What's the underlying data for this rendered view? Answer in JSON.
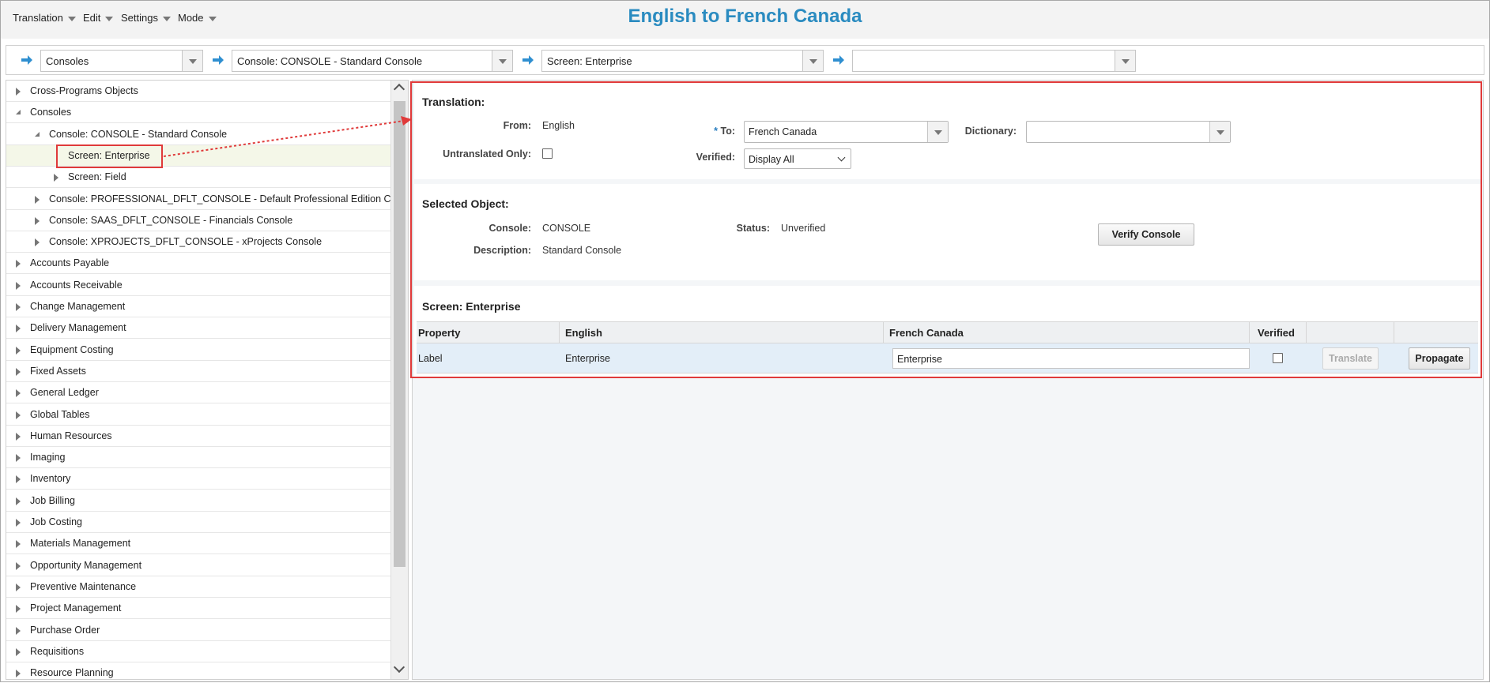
{
  "menu": [
    {
      "label": "Translation"
    },
    {
      "label": "Edit"
    },
    {
      "label": "Settings"
    },
    {
      "label": "Mode"
    }
  ],
  "title": "English to French Canada",
  "breadcrumbs": [
    {
      "value": "Consoles"
    },
    {
      "value": "Console: CONSOLE - Standard Console"
    },
    {
      "value": "Screen: Enterprise"
    },
    {
      "value": ""
    }
  ],
  "tree": [
    {
      "label": "Cross-Programs Objects",
      "level": 0,
      "state": "collapsed"
    },
    {
      "label": "Consoles",
      "level": 0,
      "state": "expanded"
    },
    {
      "label": "Console: CONSOLE - Standard Console",
      "level": 1,
      "state": "expanded"
    },
    {
      "label": "Screen: Enterprise",
      "level": 2,
      "state": "leaf",
      "selected": true
    },
    {
      "label": "Screen: Field",
      "level": 2,
      "state": "collapsed"
    },
    {
      "label": "Console: PROFESSIONAL_DFLT_CONSOLE - Default Professional Edition Cc",
      "level": 1,
      "state": "collapsed"
    },
    {
      "label": "Console: SAAS_DFLT_CONSOLE - Financials Console",
      "level": 1,
      "state": "collapsed"
    },
    {
      "label": "Console: XPROJECTS_DFLT_CONSOLE - xProjects Console",
      "level": 1,
      "state": "collapsed"
    },
    {
      "label": "Accounts Payable",
      "level": 0,
      "state": "collapsed"
    },
    {
      "label": "Accounts Receivable",
      "level": 0,
      "state": "collapsed"
    },
    {
      "label": "Change Management",
      "level": 0,
      "state": "collapsed"
    },
    {
      "label": "Delivery Management",
      "level": 0,
      "state": "collapsed"
    },
    {
      "label": "Equipment Costing",
      "level": 0,
      "state": "collapsed"
    },
    {
      "label": "Fixed Assets",
      "level": 0,
      "state": "collapsed"
    },
    {
      "label": "General Ledger",
      "level": 0,
      "state": "collapsed"
    },
    {
      "label": "Global Tables",
      "level": 0,
      "state": "collapsed"
    },
    {
      "label": "Human Resources",
      "level": 0,
      "state": "collapsed"
    },
    {
      "label": "Imaging",
      "level": 0,
      "state": "collapsed"
    },
    {
      "label": "Inventory",
      "level": 0,
      "state": "collapsed"
    },
    {
      "label": "Job Billing",
      "level": 0,
      "state": "collapsed"
    },
    {
      "label": "Job Costing",
      "level": 0,
      "state": "collapsed"
    },
    {
      "label": "Materials Management",
      "level": 0,
      "state": "collapsed"
    },
    {
      "label": "Opportunity Management",
      "level": 0,
      "state": "collapsed"
    },
    {
      "label": "Preventive Maintenance",
      "level": 0,
      "state": "collapsed"
    },
    {
      "label": "Project Management",
      "level": 0,
      "state": "collapsed"
    },
    {
      "label": "Purchase Order",
      "level": 0,
      "state": "collapsed"
    },
    {
      "label": "Requisitions",
      "level": 0,
      "state": "collapsed"
    },
    {
      "label": "Resource Planning",
      "level": 0,
      "state": "collapsed"
    }
  ],
  "translation": {
    "heading": "Translation:",
    "from_label": "From:",
    "from_value": "English",
    "to_required": "*",
    "to_label": "To:",
    "to_value": "French Canada",
    "dictionary_label": "Dictionary:",
    "dictionary_value": "",
    "untranslated_label": "Untranslated Only:",
    "untranslated_checked": false,
    "verified_label": "Verified:",
    "verified_value": "Display All"
  },
  "selected_object": {
    "heading": "Selected Object:",
    "console_label": "Console:",
    "console_value": "CONSOLE",
    "description_label": "Description:",
    "description_value": "Standard Console",
    "status_label": "Status:",
    "status_value": "Unverified",
    "verify_button": "Verify Console"
  },
  "screen": {
    "heading": "Screen: Enterprise",
    "columns": [
      "Property",
      "English",
      "French Canada",
      "Verified"
    ],
    "rows": [
      {
        "property": "Label",
        "english": "Enterprise",
        "french": "Enterprise",
        "verified": false
      }
    ],
    "translate_button": "Translate",
    "propagate_button": "Propagate"
  },
  "colors": {
    "title": "#2a8bc0",
    "callout": "#e03a3a",
    "arrow": "#2f8fd0",
    "selected_row": "#f4f7e8",
    "table_row": "#e3eef8"
  }
}
